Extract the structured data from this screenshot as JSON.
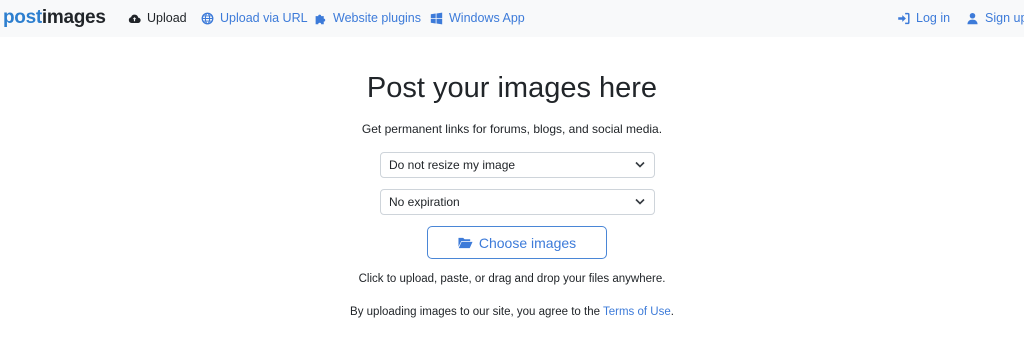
{
  "brand": {
    "part1": "post",
    "part2": "images"
  },
  "nav": {
    "upload": "Upload",
    "upload_url": "Upload via URL",
    "plugins": "Website plugins",
    "windows_app": "Windows App",
    "login": "Log in",
    "signup": "Sign up"
  },
  "main": {
    "title": "Post your images here",
    "subtitle": "Get permanent links for forums, blogs, and social media.",
    "resize_select": "Do not resize my image",
    "expiration_select": "No expiration",
    "choose_button": "Choose images",
    "hint": "Click to upload, paste, or drag and drop your files anywhere.",
    "terms_prefix": "By uploading images to our site, you agree to the ",
    "terms_link": "Terms of Use",
    "terms_suffix": "."
  },
  "colors": {
    "accent": "#3d7bd9",
    "brand_blue": "#2d7fcf",
    "navbar_bg": "#f8f9fa"
  },
  "icons": {
    "upload": "cloud-upload-icon",
    "upload_url": "globe-icon",
    "plugins": "puzzle-icon",
    "windows_app": "windows-icon",
    "login": "sign-in-icon",
    "signup": "user-icon",
    "choose": "folder-open-icon",
    "select": "chevron-down-icon"
  }
}
